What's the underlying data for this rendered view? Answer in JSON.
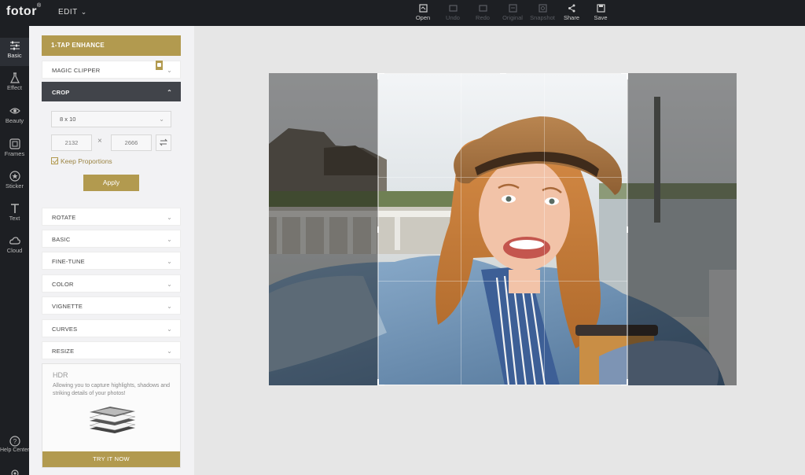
{
  "app": {
    "logo": "fotor",
    "logo_mark": "®",
    "menu": "EDIT"
  },
  "toolbar": [
    {
      "label": "Open",
      "icon": "open-icon",
      "enabled": true
    },
    {
      "label": "Undo",
      "icon": "undo-icon",
      "enabled": false
    },
    {
      "label": "Redo",
      "icon": "redo-icon",
      "enabled": false
    },
    {
      "label": "Original",
      "icon": "original-icon",
      "enabled": false
    },
    {
      "label": "Snapshot",
      "icon": "snapshot-icon",
      "enabled": false
    },
    {
      "label": "Share",
      "icon": "share-icon",
      "enabled": true
    },
    {
      "label": "Save",
      "icon": "save-icon",
      "enabled": true
    }
  ],
  "leftnav": [
    {
      "label": "Basic",
      "icon": "sliders-icon",
      "active": true
    },
    {
      "label": "Effect",
      "icon": "flask-icon",
      "active": false
    },
    {
      "label": "Beauty",
      "icon": "eye-icon",
      "active": false
    },
    {
      "label": "Frames",
      "icon": "frame-icon",
      "active": false
    },
    {
      "label": "Sticker",
      "icon": "sticker-icon",
      "active": false
    },
    {
      "label": "Text",
      "icon": "text-icon",
      "active": false
    },
    {
      "label": "Cloud",
      "icon": "cloud-icon",
      "active": false
    },
    {
      "label": "Help Center",
      "icon": "help-icon",
      "active": false
    }
  ],
  "panel": {
    "enhance": "1-TAP ENHANCE",
    "magic_clipper": "MAGIC CLIPPER",
    "crop": {
      "title": "CROP",
      "ratio": "8 x 10",
      "width": "2132",
      "times": "×",
      "height": "2666",
      "keep": "Keep Proportions",
      "apply": "Apply"
    },
    "sections": [
      "ROTATE",
      "BASIC",
      "FINE-TUNE",
      "COLOR",
      "VIGNETTE",
      "CURVES",
      "RESIZE"
    ],
    "hdr": {
      "title": "HDR",
      "desc": "Allowing you to capture highlights, shadows and striking details of your photos!",
      "cta": "TRY IT NOW"
    }
  },
  "colors": {
    "accent": "#b29a4f",
    "dark": "#1d1f23",
    "panel": "#f2f2f4",
    "canvas_bg": "#e6e6e6"
  }
}
